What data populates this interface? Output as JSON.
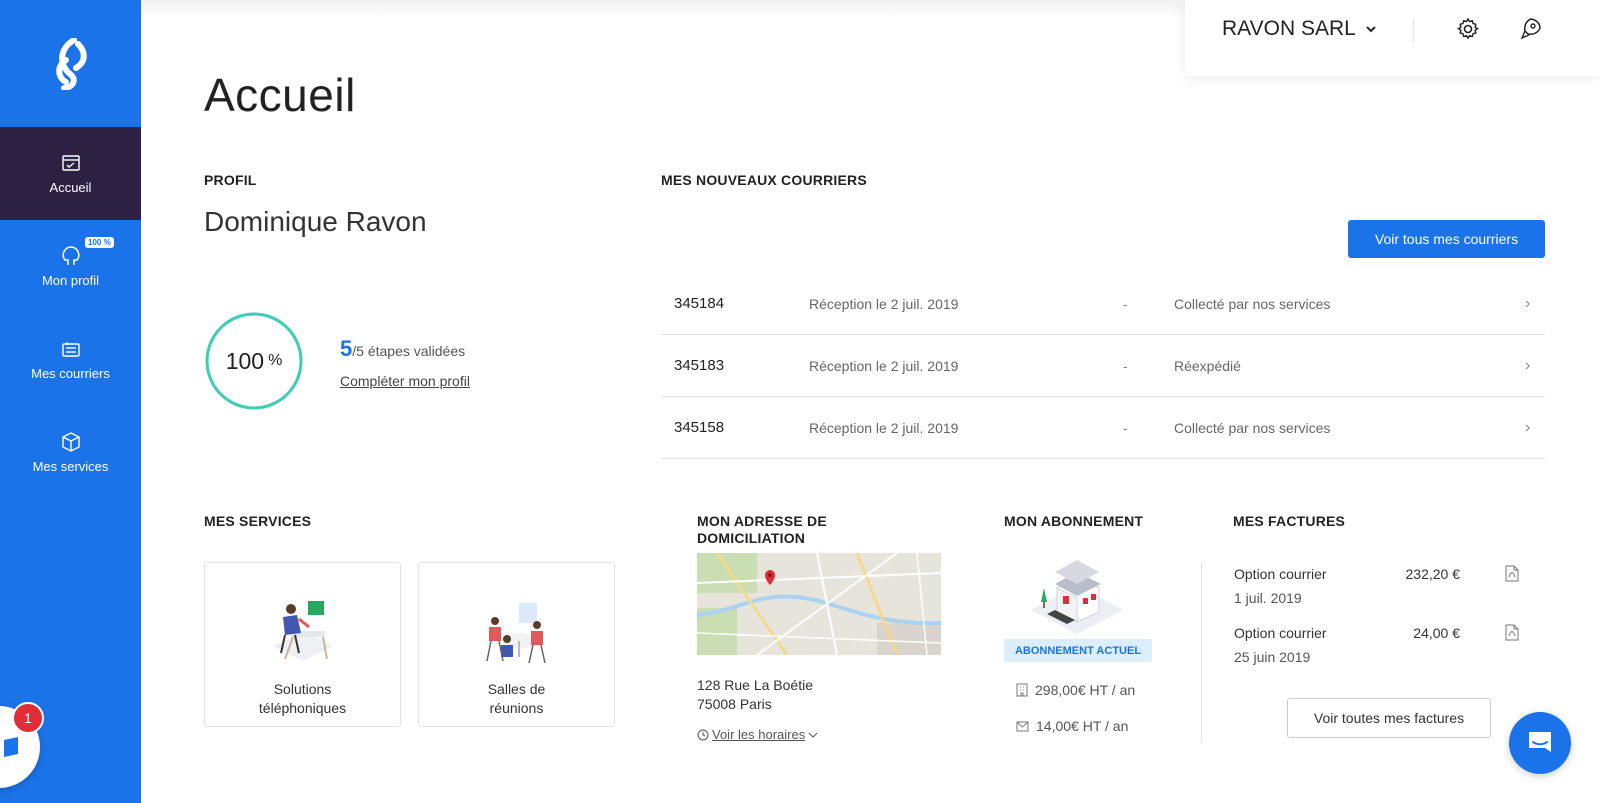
{
  "sidebar": {
    "items": [
      {
        "label": "Accueil",
        "icon": "home-icon"
      },
      {
        "label": "Mon profil",
        "icon": "profile-icon",
        "badge": "100 %"
      },
      {
        "label": "Mes courriers",
        "icon": "mail-icon"
      },
      {
        "label": "Mes services",
        "icon": "box-icon"
      }
    ],
    "chat_badge": "1"
  },
  "header": {
    "company": "RAVON SARL"
  },
  "page": {
    "title": "Accueil"
  },
  "profile": {
    "section_title": "PROFIL",
    "name": "Dominique Ravon",
    "progress_value": "100",
    "progress_unit": "%",
    "progress_fraction": 1.0,
    "steps_done": "5",
    "steps_text": "/5 étapes validées",
    "complete_link": "Compléter mon profil"
  },
  "mail": {
    "section_title": "MES NOUVEAUX COURRIERS",
    "view_all_label": "Voir tous mes courriers",
    "rows": [
      {
        "number": "345184",
        "date": "Réception le 2 juil. 2019",
        "dash": "-",
        "status": "Collecté par nos services"
      },
      {
        "number": "345183",
        "date": "Réception le 2 juil. 2019",
        "dash": "-",
        "status": "Réexpédié"
      },
      {
        "number": "345158",
        "date": "Réception le 2 juil. 2019",
        "dash": "-",
        "status": "Collecté par nos services"
      }
    ]
  },
  "services": {
    "section_title": "MES SERVICES",
    "cards": [
      {
        "label_line1": "Solutions",
        "label_line2": "téléphoniques"
      },
      {
        "label_line1": "Salles de",
        "label_line2": "réunions"
      }
    ]
  },
  "address": {
    "section_title_line1": "MON ADRESSE DE",
    "section_title_line2": "DOMICILIATION",
    "line1": "128 Rue La Boétie",
    "line2": "75008 Paris",
    "hours_link": "Voir les horaires"
  },
  "subscription": {
    "section_title": "MON ABONNEMENT",
    "badge": "ABONNEMENT ACTUEL",
    "price1": "298,00€ HT / an",
    "price2": "14,00€ HT / an"
  },
  "invoices": {
    "section_title": "MES FACTURES",
    "items": [
      {
        "label": "Option courrier",
        "date": "1 juil. 2019",
        "amount": "232,20 €"
      },
      {
        "label": "Option courrier",
        "date": "25 juin 2019",
        "amount": "24,00 €"
      }
    ],
    "view_all_label": "Voir toutes mes factures"
  },
  "colors": {
    "brand_blue": "#1a73e8",
    "active_nav": "#2d2143",
    "progress_ring": "#3ecdb5",
    "notification_red": "#e02d38"
  }
}
